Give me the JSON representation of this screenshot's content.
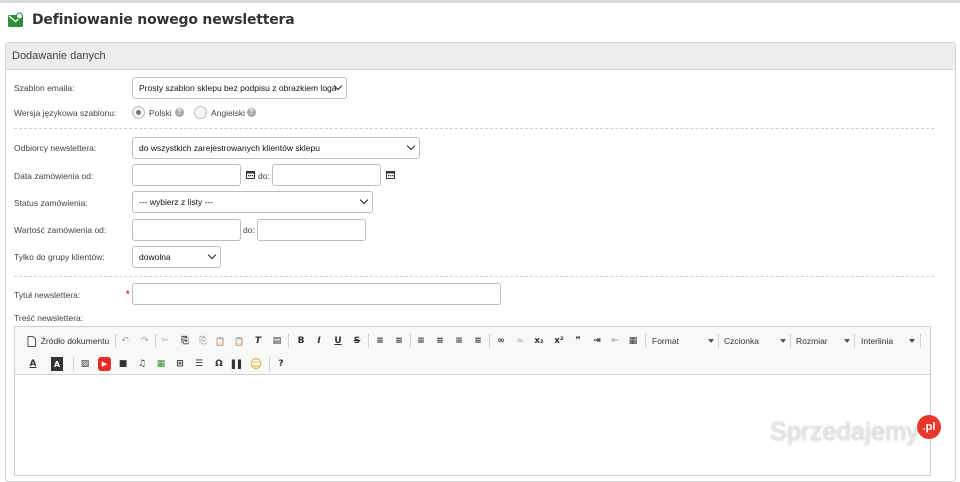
{
  "page": {
    "title": "Definiowanie nowego newslettera",
    "panel_title": "Dodawanie danych"
  },
  "form": {
    "template": {
      "label": "Szablon emaila:",
      "value": "Prosty szablon sklepu bez podpisu z obrazkiem loga"
    },
    "language": {
      "label": "Wersja językowa szablonu:",
      "options": [
        "Polski",
        "Angielski"
      ],
      "selected": "Polski"
    },
    "recipients": {
      "label": "Odbiorcy newslettera:",
      "value": "do wszystkich zarejestrowanych klientów sklepu"
    },
    "order_date": {
      "label": "Data zamówienia od:",
      "to_label": "do:",
      "from_value": "",
      "to_value": ""
    },
    "order_status": {
      "label": "Status zamówienia:",
      "value": "--- wybierz z listy ---"
    },
    "order_value": {
      "label": "Wartość zamówienia od:",
      "to_label": "do:",
      "from_value": "",
      "to_value": ""
    },
    "customer_group": {
      "label": "Tylko do grupy klientów:",
      "value": "dowolna"
    },
    "title": {
      "label": "Tytuł newslettera:",
      "required_mark": "*",
      "value": ""
    },
    "content": {
      "label": "Treść newslettera:"
    }
  },
  "editor": {
    "source_label": "Źródło dokumentu",
    "combos": {
      "format": "Format",
      "font": "Czcionka",
      "size": "Rozmiar",
      "line_height": "Interlinia"
    },
    "glyphs": {
      "undo": "↶",
      "redo": "↷",
      "cut": "✂",
      "paste_text": "⎘",
      "copy": "⎘",
      "paste": "📋",
      "paste_word": "📋",
      "clear_format": "T",
      "templates": "▤",
      "bold": "B",
      "italic": "I",
      "underline": "U",
      "strike": "S",
      "numbered_list": "≡",
      "bullet_list": "≡",
      "align_left": "≡",
      "align_center": "≡",
      "align_right": "≡",
      "justify": "≡",
      "link": "∞",
      "unlink": "∞",
      "subscript": "x₂",
      "superscript": "x²",
      "quote": "❞",
      "indent": "⇥",
      "outdent": "⇤",
      "show_blocks": "▦",
      "text_color": "A",
      "bg_color": "A",
      "image": "▨",
      "youtube": "▶",
      "video": "■",
      "audio": "♫",
      "media": "▦",
      "table": "⊞",
      "hr": "☰",
      "special_char": "Ω",
      "page_break": "▌▌",
      "smiley": "☺",
      "help": "?"
    }
  },
  "watermark": {
    "text": "Sprzedajemy",
    "badge": ".pl"
  }
}
